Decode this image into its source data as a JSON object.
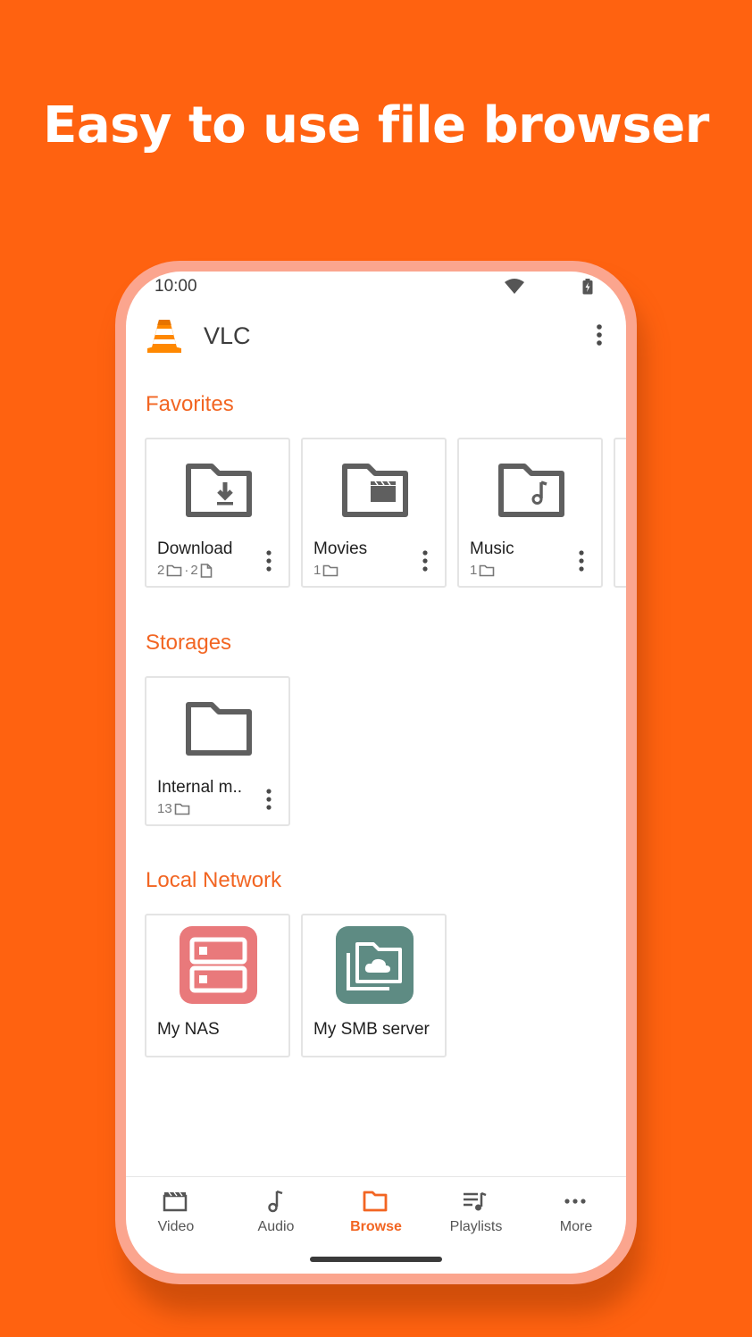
{
  "headline": "Easy to use file browser",
  "status_bar": {
    "time": "10:00"
  },
  "app_bar": {
    "title": "VLC"
  },
  "sections": {
    "favorites": "Favorites",
    "storages": "Storages",
    "local_network": "Local Network"
  },
  "favorites": [
    {
      "title": "Download",
      "folders": "2",
      "files": "2",
      "icon": "download-folder-icon"
    },
    {
      "title": "Movies",
      "folders": "1",
      "icon": "movies-folder-icon"
    },
    {
      "title": "Music",
      "folders": "1",
      "icon": "music-folder-icon"
    }
  ],
  "storages": [
    {
      "title": "Internal m..",
      "folders": "13",
      "icon": "folder-icon"
    }
  ],
  "network": [
    {
      "title": "My NAS",
      "icon": "nas-server-icon",
      "color": "#E9797B"
    },
    {
      "title": "My SMB server",
      "icon": "smb-server-icon",
      "color": "#5E8B83"
    }
  ],
  "separator": "·",
  "bottom_nav": [
    {
      "label": "Video",
      "icon": "video-icon"
    },
    {
      "label": "Audio",
      "icon": "audio-icon"
    },
    {
      "label": "Browse",
      "icon": "browse-folder-icon",
      "active": true
    },
    {
      "label": "Playlists",
      "icon": "playlists-icon"
    },
    {
      "label": "More",
      "icon": "more-dots-icon"
    }
  ],
  "colors": {
    "background": "#FF6210",
    "accent": "#F26522",
    "phone_frame": "#FBA58E"
  }
}
